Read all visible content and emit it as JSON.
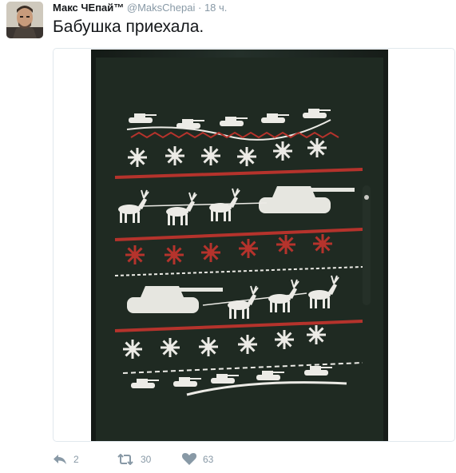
{
  "tweet": {
    "author_name": "Макс ЧЕпай™",
    "author_handle": "@MaksChepai",
    "separator": "·",
    "timestamp": "18 ч.",
    "text": "Бабушка приехала."
  },
  "actions": {
    "reply_count": "2",
    "retweet_count": "30",
    "like_count": "63"
  },
  "icons": {
    "reply": "reply-icon",
    "retweet": "retweet-icon",
    "like": "heart-icon"
  },
  "colors": {
    "sweater_green": "#1f2a22",
    "pattern_red": "#b5332c",
    "pattern_white": "#ecebe6",
    "meta_gray": "#8899a6"
  }
}
